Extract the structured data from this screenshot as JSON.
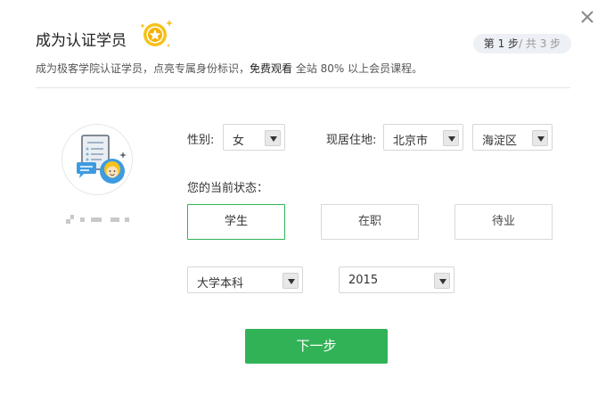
{
  "dialog": {
    "title": "成为认证学员",
    "close_icon": "close-icon",
    "badge_icon": "star-medal-icon",
    "step": {
      "current_prefix": "第 1 步",
      "total_suffix": "/ 共 3 步"
    },
    "subtitle": {
      "part1": "成为极客学院认证学员，点亮专属身份标识，",
      "strong": "免费观看",
      "part2": " 全站 80% 以上会员课程。"
    }
  },
  "profile": {
    "avatar_icon": "certificate-avatar-icon"
  },
  "form": {
    "gender": {
      "label": "性别:",
      "value": "女"
    },
    "residence": {
      "label": "现居住地:",
      "city": "北京市",
      "district": "海淀区"
    },
    "status": {
      "label": "您的当前状态：",
      "options": [
        "学生",
        "在职",
        "待业"
      ],
      "selected": "学生"
    },
    "education": {
      "value": "大学本科"
    },
    "year": {
      "value": "2015"
    }
  },
  "actions": {
    "next_label": "下一步"
  },
  "colors": {
    "accent": "#32b257",
    "pill_bg": "#edf0f4"
  }
}
